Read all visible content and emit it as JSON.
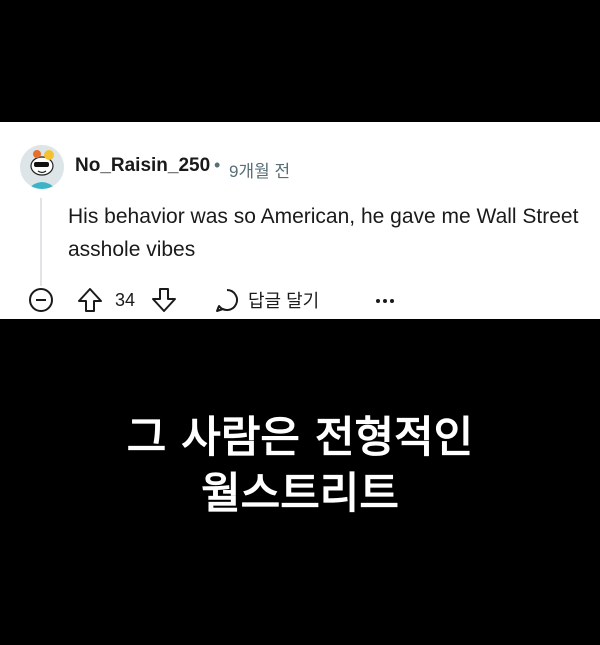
{
  "comment": {
    "author": "No_Raisin_250",
    "separator": "•",
    "timestamp": "9개월 전",
    "body": "His behavior was so American, he gave me Wall Street asshole vibes",
    "score": "34",
    "reply_label": "답글 달기",
    "icons": {
      "collapse": "collapse-minus-icon",
      "upvote": "upvote-arrow-icon",
      "downvote": "downvote-arrow-icon",
      "reply": "speech-bubble-icon",
      "more": "more-options-icon"
    }
  },
  "caption": {
    "line1": "그 사람은 전형적인",
    "line2": "월스트리트"
  }
}
